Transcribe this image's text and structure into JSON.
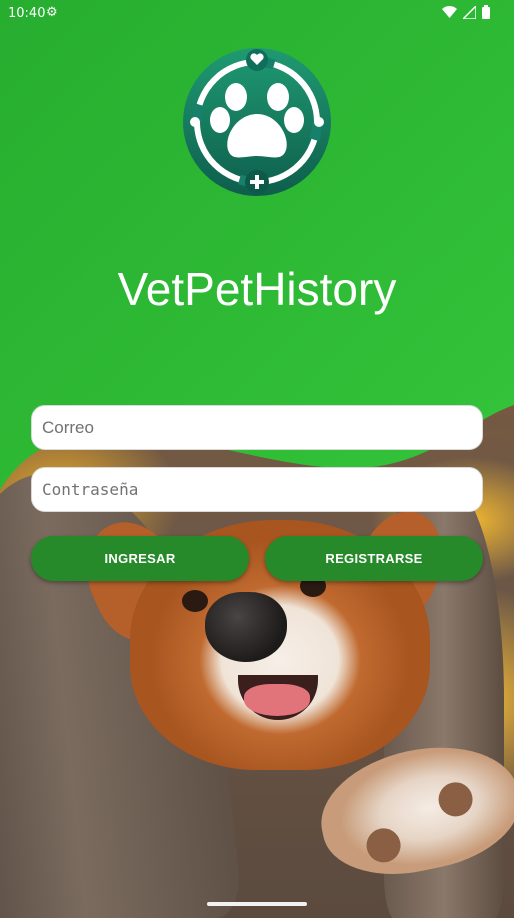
{
  "status_bar": {
    "time": "10:40",
    "icons": [
      "settings-gear-icon",
      "wifi-icon",
      "signal-icon",
      "battery-icon"
    ]
  },
  "app": {
    "title": "VetPetHistory",
    "logo_icon": "paw-medical-logo"
  },
  "form": {
    "email_placeholder": "Correo",
    "password_placeholder": "Contraseña",
    "login_label": "INGRESAR",
    "register_label": "REGISTRARSE"
  },
  "colors": {
    "header_green": "#2db535",
    "button_green": "#278a2a",
    "logo_teal": "#1a8a6a"
  }
}
